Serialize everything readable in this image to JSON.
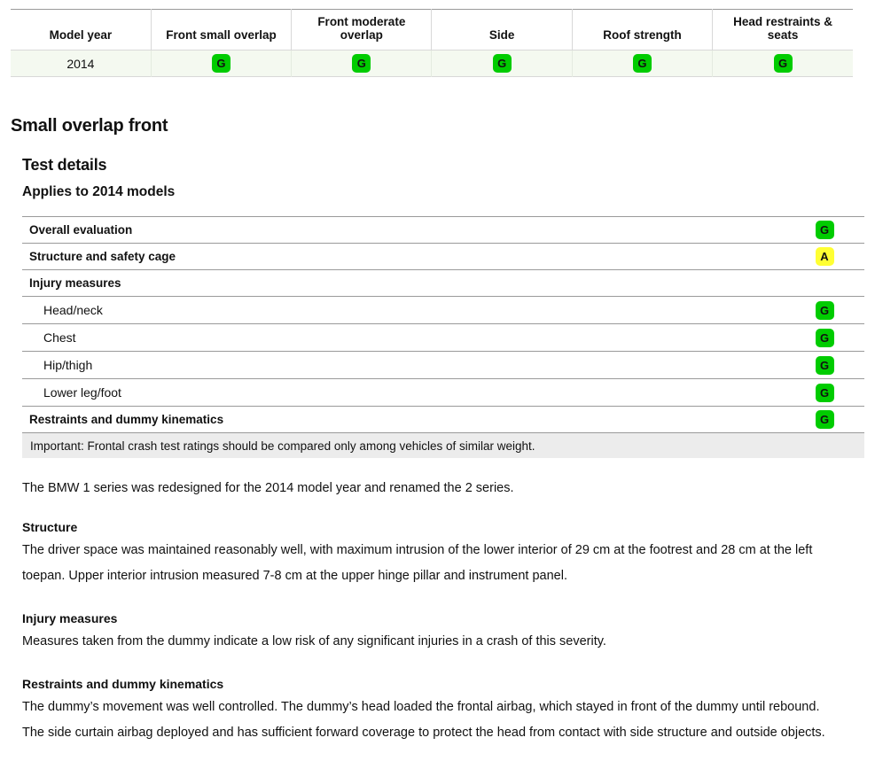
{
  "summary_table": {
    "columns": [
      "Model year",
      "Front small overlap",
      "Front moderate overlap",
      "Side",
      "Roof strength",
      "Head restraints & seats"
    ],
    "rows": [
      {
        "model_year": "2014",
        "ratings": [
          {
            "letter": "G",
            "class": "g"
          },
          {
            "letter": "G",
            "class": "g"
          },
          {
            "letter": "G",
            "class": "g"
          },
          {
            "letter": "G",
            "class": "g"
          },
          {
            "letter": "G",
            "class": "g"
          }
        ]
      }
    ]
  },
  "headings": {
    "section_title": "Small overlap front",
    "sub_title": "Test details",
    "applies_title": "Applies to 2014 models"
  },
  "detail_rows": [
    {
      "label": "Overall evaluation",
      "bold": true,
      "indent": false,
      "letter": "G",
      "class": "g"
    },
    {
      "label": "Structure and safety cage",
      "bold": true,
      "indent": false,
      "letter": "A",
      "class": "a"
    },
    {
      "label": "Injury measures",
      "bold": true,
      "indent": false,
      "letter": "",
      "class": ""
    },
    {
      "label": "Head/neck",
      "bold": false,
      "indent": true,
      "letter": "G",
      "class": "g"
    },
    {
      "label": "Chest",
      "bold": false,
      "indent": true,
      "letter": "G",
      "class": "g"
    },
    {
      "label": "Hip/thigh",
      "bold": false,
      "indent": true,
      "letter": "G",
      "class": "g"
    },
    {
      "label": "Lower leg/foot",
      "bold": false,
      "indent": true,
      "letter": "G",
      "class": "g"
    },
    {
      "label": "Restraints and dummy kinematics",
      "bold": true,
      "indent": false,
      "letter": "G",
      "class": "g"
    }
  ],
  "important_note": "Important: Frontal crash test ratings should be compared only among vehicles of similar weight.",
  "lead_paragraph": "The BMW 1 series was redesigned for the 2014 model year and renamed the 2 series.",
  "prose_sections": [
    {
      "heading": "Structure",
      "text": "The driver space was maintained reasonably well, with maximum intrusion of the lower interior of 29 cm at the footrest and 28 cm at the left toepan. Upper interior intrusion measured 7-8 cm at the upper hinge pillar and instrument panel."
    },
    {
      "heading": "Injury measures",
      "text": "Measures taken from the dummy indicate a low risk of any significant injuries in a crash of this severity."
    },
    {
      "heading": "Restraints and dummy kinematics",
      "text": "The dummy’s movement was well controlled. The dummy’s head loaded the frontal airbag, which stayed in front of the dummy until rebound. The side curtain airbag deployed and has sufficient forward coverage to protect the head from contact with side structure and outside objects."
    }
  ],
  "colors": {
    "good": "#00cc00",
    "acceptable": "#ffff33",
    "marginal": "#ff9900",
    "poor": "#ff0000",
    "row_tint": "#f4f9f0",
    "note_bg": "#ececec"
  }
}
